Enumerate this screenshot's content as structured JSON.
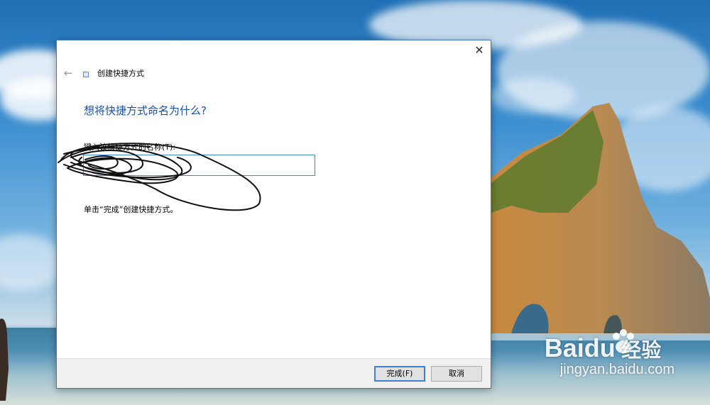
{
  "wizard": {
    "title": "创建快捷方式",
    "heading": "想将快捷方式命名为什么?",
    "name_label": "键入该快捷方式的名称(T):",
    "name_value": "",
    "hint": "单击“完成”创建快捷方式。",
    "buttons": {
      "finish": "完成(F)",
      "cancel": "取消"
    },
    "icons": {
      "back": "back-arrow-icon",
      "close": "close-icon",
      "wizard": "shortcut-icon"
    }
  },
  "watermark": {
    "brand": "Baidu",
    "suffix": "经验",
    "url": "jingyan.baidu.com"
  },
  "colors": {
    "heading": "#1b4f9c",
    "input_border": "#3c87d6",
    "window_border": "#3c78c8"
  }
}
